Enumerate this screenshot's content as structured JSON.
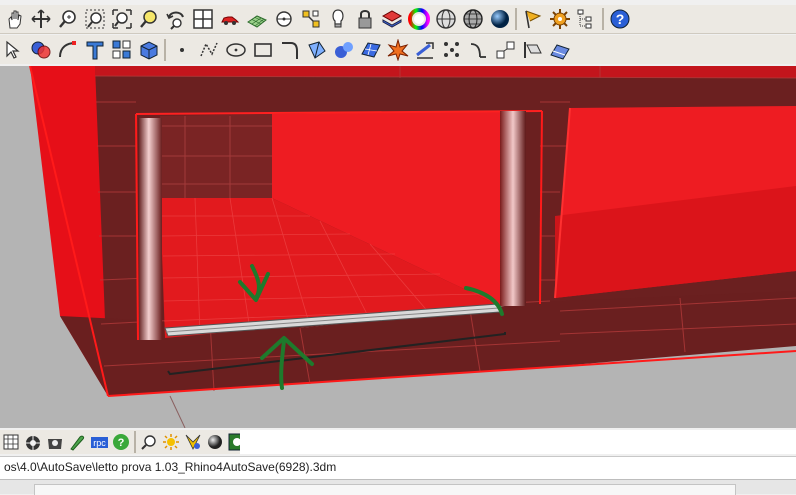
{
  "toolbar_main": {
    "buttons": [
      {
        "icon": "pan-hand-icon"
      },
      {
        "icon": "rotate-view-icon"
      },
      {
        "icon": "zoom-icon"
      },
      {
        "icon": "zoom-window-icon"
      },
      {
        "icon": "zoom-extents-icon"
      },
      {
        "icon": "zoom-selected-icon"
      },
      {
        "icon": "undo-view-icon"
      },
      {
        "icon": "four-viewports-icon"
      },
      {
        "icon": "car-icon"
      },
      {
        "icon": "grid-plane-icon"
      },
      {
        "icon": "target-icon"
      },
      {
        "icon": "snap-icon"
      },
      {
        "icon": "light-bulb-icon"
      },
      {
        "icon": "lock-icon"
      },
      {
        "icon": "layer-icon"
      },
      {
        "icon": "color-wheel-icon"
      },
      {
        "icon": "wireframe-sphere-icon"
      },
      {
        "icon": "ghosted-sphere-icon"
      },
      {
        "icon": "shaded-sphere-icon"
      },
      {
        "icon": "flag-icon"
      },
      {
        "icon": "gear-icon"
      },
      {
        "icon": "tree-icon"
      },
      {
        "icon": "help-icon"
      }
    ]
  },
  "toolbar_secondary": {
    "buttons": [
      {
        "icon": "select-arrow-icon"
      },
      {
        "icon": "boolean-icon"
      },
      {
        "icon": "arc-icon"
      },
      {
        "icon": "text-t-icon"
      },
      {
        "icon": "group-icon"
      },
      {
        "icon": "box-icon"
      },
      {
        "icon": "point-icon"
      },
      {
        "icon": "polyline-icon"
      },
      {
        "icon": "ellipse-icon"
      },
      {
        "icon": "rectangle-icon"
      },
      {
        "icon": "fillet-curve-icon"
      },
      {
        "icon": "surface-patch-icon"
      },
      {
        "icon": "solid-spheres-icon"
      },
      {
        "icon": "mesh-plane-icon"
      },
      {
        "icon": "explode-icon"
      },
      {
        "icon": "dimension-icon"
      },
      {
        "icon": "points-grid-icon"
      },
      {
        "icon": "blend-curve-icon"
      },
      {
        "icon": "transform-icon"
      },
      {
        "icon": "align-icon"
      },
      {
        "icon": "measure-icon"
      }
    ]
  },
  "toolbar_render": {
    "buttons": [
      {
        "icon": "render-grid-icon"
      },
      {
        "icon": "render-teapot-icon"
      },
      {
        "icon": "render-save-icon"
      },
      {
        "icon": "render-brush-icon"
      },
      {
        "icon": "rpc-icon",
        "label": "rpc"
      },
      {
        "icon": "help-green-icon"
      },
      {
        "icon": "render-zoom-icon"
      },
      {
        "icon": "sun-icon"
      },
      {
        "icon": "render-light-icon"
      },
      {
        "icon": "render-sphere-icon"
      },
      {
        "icon": "render-preview-icon"
      }
    ]
  },
  "status": {
    "file_path": "os\\4.0\\AutoSave\\letto prova 1.03_Rhino4AutoSave(6928).3dm"
  },
  "colors": {
    "model_red": "#e8101a",
    "model_dark": "#6e1f1f",
    "ground": "#b3b3b3",
    "annotation_green": "#1e7a2c"
  }
}
